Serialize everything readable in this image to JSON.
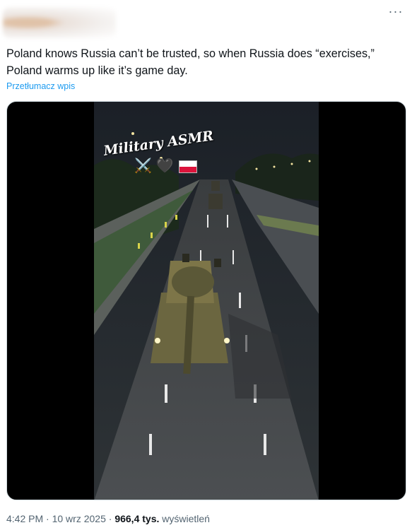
{
  "post": {
    "more_icon": "···",
    "text_line1": "Poland knows Russia can’t be trusted, so when Russia does “exercises,”",
    "text_line2": "Poland warms up like it’s game day.",
    "translate_label": "Przetłumacz wpis"
  },
  "video": {
    "overlay_title": "Military ASMR",
    "overlay_swords": "⚔️",
    "overlay_heart": "🖤"
  },
  "meta": {
    "time": "4:42 PM",
    "date": "10 wrz 2025",
    "views_count": "966,4 tys.",
    "views_label": "wyświetleń"
  }
}
